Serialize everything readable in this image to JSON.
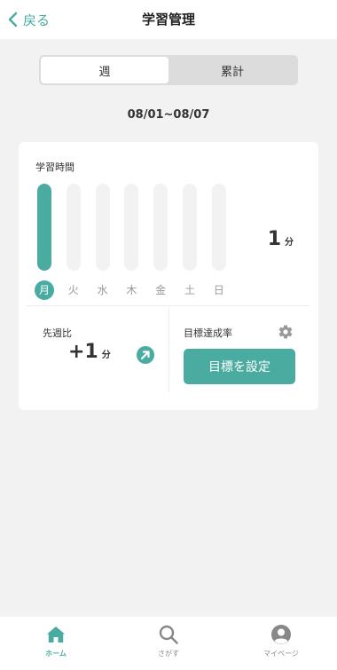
{
  "header": {
    "back_label": "戻る",
    "title": "学習管理"
  },
  "segment": {
    "tabs": [
      "週",
      "累計"
    ],
    "selected": 0
  },
  "date_range": "08/01~08/07",
  "study_time": {
    "label": "学習時間",
    "days": [
      "月",
      "火",
      "水",
      "木",
      "金",
      "土",
      "日"
    ],
    "values_min": [
      1,
      0,
      0,
      0,
      0,
      0,
      0
    ],
    "active_day": 0,
    "total_value": "1",
    "total_unit": "分"
  },
  "comparison": {
    "label": "先週比",
    "value": "+1",
    "unit": "分"
  },
  "goal": {
    "label": "目標達成率",
    "button": "目標を設定"
  },
  "tabbar": {
    "items": [
      "ホーム",
      "さがす",
      "マイページ"
    ],
    "active": 0
  },
  "colors": {
    "accent": "#4aaba0",
    "bar_inactive": "#f2f2f2",
    "background": "#f2f2f2"
  }
}
